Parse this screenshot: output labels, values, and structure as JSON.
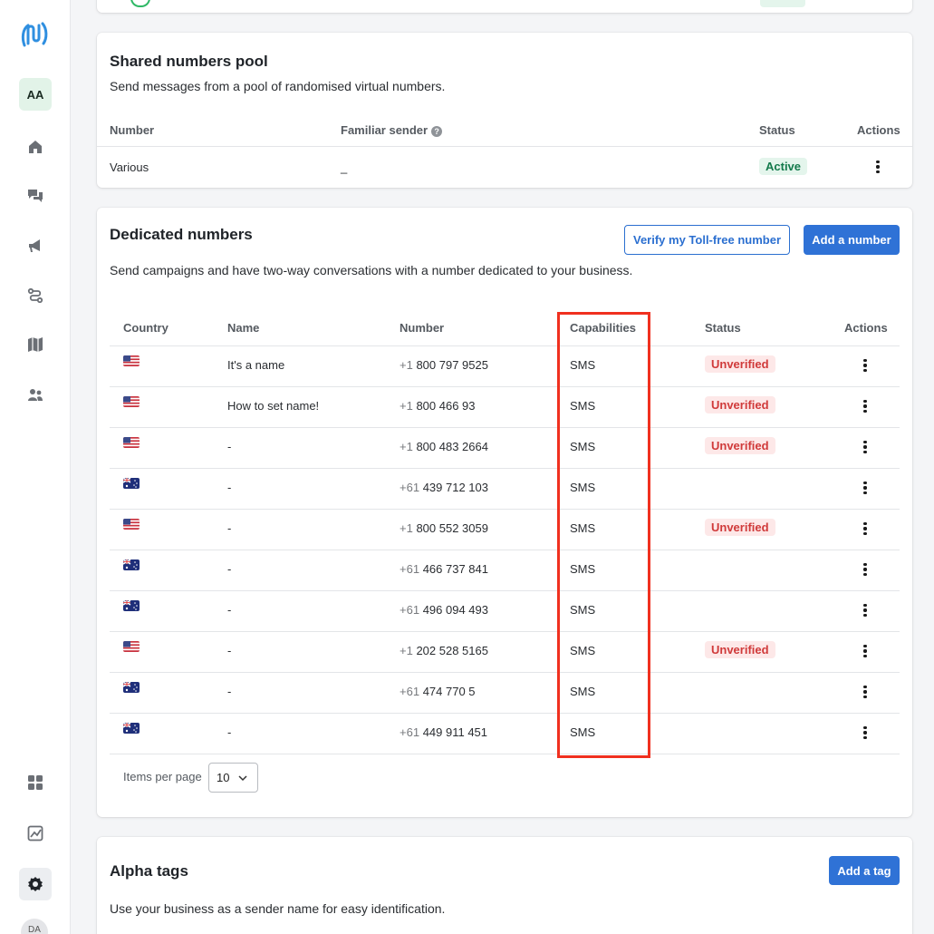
{
  "sidebar": {
    "workspace_initials": "AA",
    "user_initials": "DA",
    "nav_icons": [
      "home-icon",
      "chat-icon",
      "megaphone-icon",
      "flow-icon",
      "map-icon",
      "contacts-icon",
      "apps-icon",
      "chart-icon",
      "settings-icon"
    ]
  },
  "shared_pool": {
    "title": "Shared numbers pool",
    "description": "Send messages from a pool of randomised virtual numbers.",
    "headers": {
      "number": "Number",
      "familiar_sender": "Familiar sender",
      "status": "Status",
      "actions": "Actions"
    },
    "row": {
      "number": "Various",
      "familiar_sender": "_",
      "status": "Active"
    }
  },
  "dedicated": {
    "title": "Dedicated numbers",
    "description": "Send campaigns and have two-way conversations with a number dedicated to your business.",
    "verify_button": "Verify my Toll-free number",
    "add_button": "Add a number",
    "headers": {
      "country": "Country",
      "name": "Name",
      "number": "Number",
      "capabilities": "Capabilities",
      "status": "Status",
      "actions": "Actions"
    },
    "rows": [
      {
        "country": "US",
        "name": "It's a name",
        "prefix": "+1",
        "number": "800 797 9525",
        "capabilities": "SMS",
        "status": "Unverified"
      },
      {
        "country": "US",
        "name": "How to set name!",
        "prefix": "+1",
        "number": "800 466 93",
        "capabilities": "SMS",
        "status": "Unverified"
      },
      {
        "country": "US",
        "name": "-",
        "prefix": "+1",
        "number": "800 483 2664",
        "capabilities": "SMS",
        "status": "Unverified"
      },
      {
        "country": "AU",
        "name": "-",
        "prefix": "+61",
        "number": "439 712 103",
        "capabilities": "SMS",
        "status": ""
      },
      {
        "country": "US",
        "name": "-",
        "prefix": "+1",
        "number": "800 552 3059",
        "capabilities": "SMS",
        "status": "Unverified"
      },
      {
        "country": "AU",
        "name": "-",
        "prefix": "+61",
        "number": "466 737 841",
        "capabilities": "SMS",
        "status": ""
      },
      {
        "country": "AU",
        "name": "-",
        "prefix": "+61",
        "number": "496 094 493",
        "capabilities": "SMS",
        "status": ""
      },
      {
        "country": "US",
        "name": "-",
        "prefix": "+1",
        "number": "202 528 5165",
        "capabilities": "SMS",
        "status": "Unverified"
      },
      {
        "country": "AU",
        "name": "-",
        "prefix": "+61",
        "number": "474 770 5",
        "capabilities": "SMS",
        "status": ""
      },
      {
        "country": "AU",
        "name": "-",
        "prefix": "+61",
        "number": "449 911 451",
        "capabilities": "SMS",
        "status": ""
      }
    ],
    "items_per_page_label": "Items per page",
    "items_per_page_value": "10"
  },
  "alpha_tags": {
    "title": "Alpha tags",
    "description": "Use your business as a sender name for easy identification.",
    "add_button": "Add a tag"
  },
  "colors": {
    "primary": "#2f72d6",
    "active_badge": "#137a4b",
    "unverified_badge": "#d03a3a",
    "highlight": "#f0301f"
  }
}
